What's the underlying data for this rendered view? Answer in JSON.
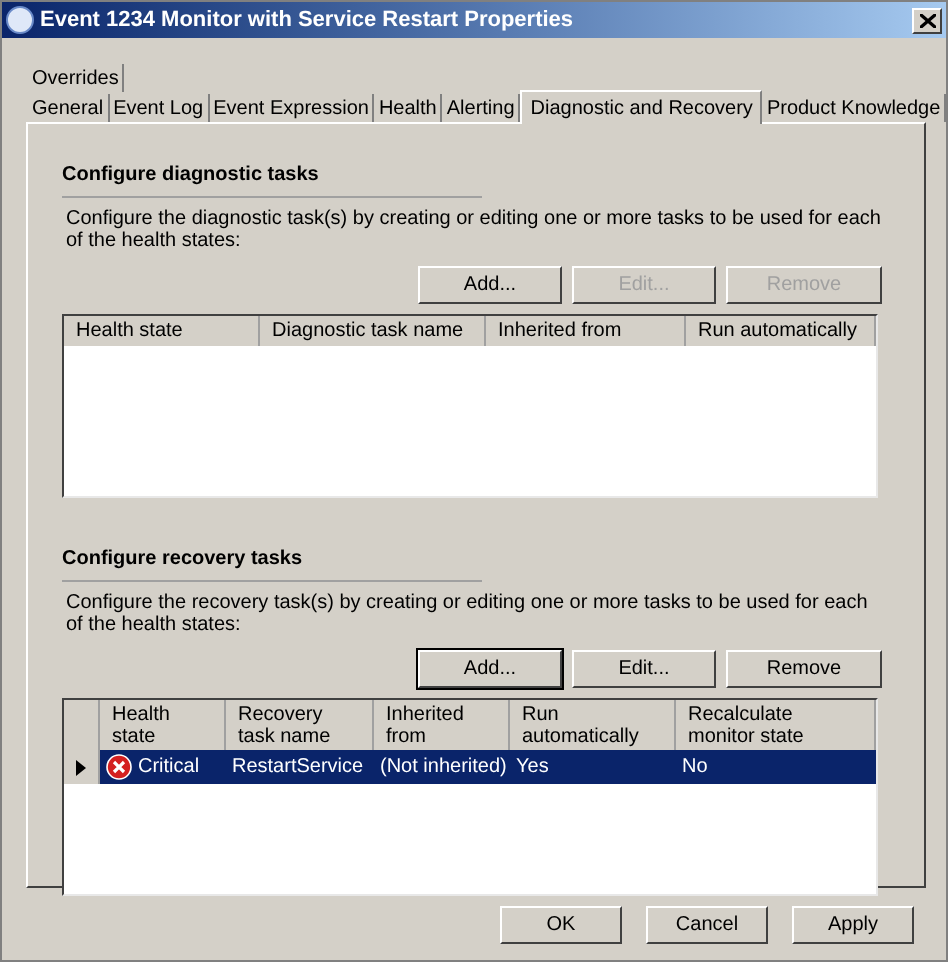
{
  "window": {
    "title": "Event 1234 Monitor with Service Restart Properties"
  },
  "tabs": [
    [
      {
        "label": "Overrides",
        "selected": false
      }
    ],
    [
      {
        "label": "General",
        "selected": false
      },
      {
        "label": "Event Log",
        "selected": false
      },
      {
        "label": "Event Expression",
        "selected": false
      },
      {
        "label": "Health",
        "selected": false
      },
      {
        "label": "Alerting",
        "selected": false
      },
      {
        "label": "Diagnostic and Recovery",
        "selected": true
      },
      {
        "label": "Product Knowledge",
        "selected": false
      }
    ]
  ],
  "diagnostic": {
    "heading": "Configure diagnostic tasks",
    "description": "Configure the diagnostic task(s) by creating or editing one or more tasks to be used for each of the health states:",
    "buttons": [
      {
        "label": "Add...",
        "disabled": false
      },
      {
        "label": "Edit...",
        "disabled": true
      },
      {
        "label": "Remove",
        "disabled": true
      }
    ],
    "columns": [
      "Health state",
      "Diagnostic task name",
      "Inherited from",
      "Run automatically"
    ]
  },
  "recovery": {
    "heading": "Configure recovery tasks",
    "description": "Configure the recovery task(s) by creating or editing one or more tasks to be used for each of the health states:",
    "buttons": [
      {
        "label": "Add...",
        "disabled": false
      },
      {
        "label": "Edit...",
        "disabled": false
      },
      {
        "label": "Remove",
        "disabled": false
      }
    ],
    "columns": [
      "Health state",
      "Recovery task name",
      "Inherited from",
      "Run automatically",
      "Recalculate monitor state"
    ],
    "rows": [
      {
        "selected": true,
        "kind": "critical",
        "cells": [
          "Critical",
          "RestartService",
          "(Not inherited)",
          "Yes",
          "No"
        ]
      }
    ]
  },
  "footer_buttons": [
    {
      "label": "OK"
    },
    {
      "label": "Cancel"
    },
    {
      "label": "Apply"
    }
  ]
}
